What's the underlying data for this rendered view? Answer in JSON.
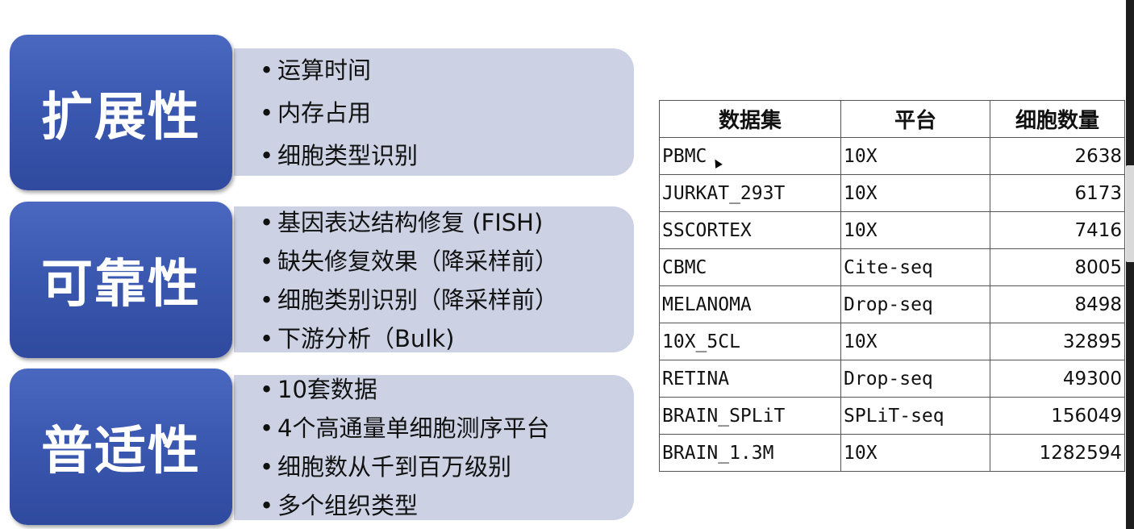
{
  "sections": [
    {
      "title": "扩展性",
      "bullets": [
        "运算时间",
        "内存占用",
        "细胞类型识别"
      ]
    },
    {
      "title": "可靠性",
      "bullets": [
        "基因表达结构修复 (FISH)",
        "缺失修复效果（降采样前）",
        "细胞类别识别（降采样前）",
        "下游分析（Bulk)"
      ]
    },
    {
      "title": "普适性",
      "bullets": [
        "10套数据",
        "4个高通量单细胞测序平台",
        "细胞数从千到百万级别",
        "多个组织类型"
      ]
    }
  ],
  "table": {
    "headers": [
      "数据集",
      "平台",
      "细胞数量"
    ],
    "rows": [
      [
        "PBMC",
        "10X",
        "2638"
      ],
      [
        "JURKAT_293T",
        "10X",
        "6173"
      ],
      [
        "SSCORTEX",
        "10X",
        "7416"
      ],
      [
        "CBMC",
        "Cite-seq",
        "8005"
      ],
      [
        "MELANOMA",
        "Drop-seq",
        "8498"
      ],
      [
        "10X_5CL",
        "10X",
        "32895"
      ],
      [
        "RETINA",
        "Drop-seq",
        "49300"
      ],
      [
        "BRAIN_SPLiT",
        "SPLiT-seq",
        "156049"
      ],
      [
        "BRAIN_1.3M",
        "10X",
        "1282594"
      ]
    ]
  },
  "colors": {
    "label_bg": "#3a57af",
    "panel_bg": "#ccd2e3"
  }
}
